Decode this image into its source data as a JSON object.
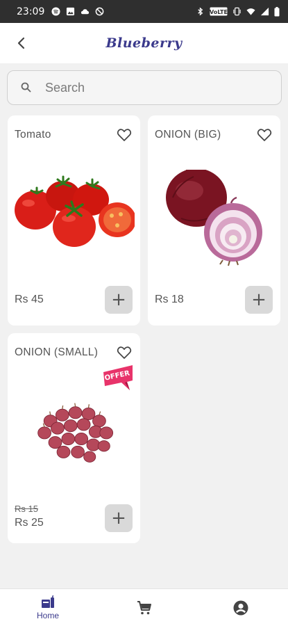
{
  "status_bar": {
    "time": "23:09"
  },
  "app_bar": {
    "title": "Blueberry",
    "back_icon": "arrow-left-icon"
  },
  "search": {
    "placeholder": "Search"
  },
  "products": [
    {
      "name": "Tomato",
      "price": "Rs 45",
      "old_price": ""
    },
    {
      "name": "ONION (BIG)",
      "price": "Rs 18",
      "old_price": ""
    },
    {
      "name": "ONION (SMALL)",
      "price": "Rs 25",
      "old_price": "Rs 15",
      "badge": "OFFER"
    }
  ],
  "bottom_nav": {
    "items": [
      {
        "label": "Home",
        "icon": "home-basket-icon",
        "active": true
      },
      {
        "label": "",
        "icon": "cart-icon",
        "active": false
      },
      {
        "label": "",
        "icon": "account-icon",
        "active": false
      }
    ]
  },
  "colors": {
    "accent": "#3b3a8c",
    "offer": "#e8336a",
    "background": "#f1f1f1"
  }
}
